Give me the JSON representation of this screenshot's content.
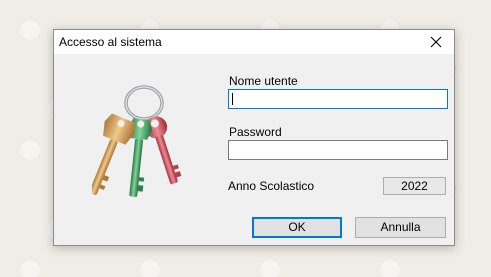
{
  "window": {
    "title": "Accesso al sistema",
    "close_icon": "close-icon"
  },
  "form": {
    "username_label": "Nome utente",
    "username_value": "",
    "password_label": "Password",
    "password_value": "",
    "year_label": "Anno Scolastico",
    "year_value": "2022"
  },
  "buttons": {
    "ok_label": "OK",
    "cancel_label": "Annulla"
  },
  "graphic": {
    "icon": "keys-icon"
  },
  "colors": {
    "focus_accent": "#0078d7",
    "key_gold": "#d4a060",
    "key_green": "#3f9a5c",
    "key_red": "#c8505a"
  }
}
